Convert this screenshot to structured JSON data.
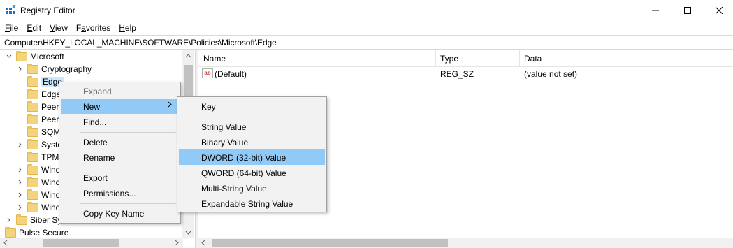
{
  "window": {
    "title": "Registry Editor",
    "icon": "registry-editor-icon"
  },
  "menu": [
    {
      "key": "F",
      "rest": "ile"
    },
    {
      "key": "E",
      "rest": "dit"
    },
    {
      "key": "V",
      "rest": "iew"
    },
    {
      "key": "",
      "pre": "F",
      "key2": "a",
      "rest": "vorites"
    },
    {
      "key": "H",
      "rest": "elp"
    }
  ],
  "address": "Computer\\HKEY_LOCAL_MACHINE\\SOFTWARE\\Policies\\Microsoft\\Edge",
  "tree": {
    "items": [
      {
        "label": "Microsoft",
        "expanded": true
      },
      {
        "label": "Cryptography"
      },
      {
        "label": "Edge",
        "selected": true
      },
      {
        "label": "Edge"
      },
      {
        "label": "Peer"
      },
      {
        "label": "Peer"
      },
      {
        "label": "SQM"
      },
      {
        "label": "Syste"
      },
      {
        "label": "TPM"
      },
      {
        "label": "Wind"
      },
      {
        "label": "Wind"
      },
      {
        "label": "Wind"
      },
      {
        "label": "Wind"
      },
      {
        "label": "Siber Systems"
      },
      {
        "label": "Pulse Secure"
      }
    ]
  },
  "list": {
    "columns": [
      "Name",
      "Type",
      "Data"
    ],
    "rows": [
      {
        "name": "(Default)",
        "type": "REG_SZ",
        "data": "(value not set)"
      }
    ]
  },
  "context_menu": {
    "items": [
      "Expand",
      "New",
      "Find...",
      "Delete",
      "Rename",
      "Export",
      "Permissions...",
      "Copy Key Name"
    ]
  },
  "submenu": {
    "items": [
      "Key",
      "String Value",
      "Binary Value",
      "DWORD (32-bit) Value",
      "QWORD (64-bit) Value",
      "Multi-String Value",
      "Expandable String Value"
    ],
    "highlighted": "DWORD (32-bit) Value"
  },
  "colors": {
    "highlight": "#91c9f7",
    "selection": "#cce8ff",
    "menu_bg": "#f2f2f2"
  }
}
